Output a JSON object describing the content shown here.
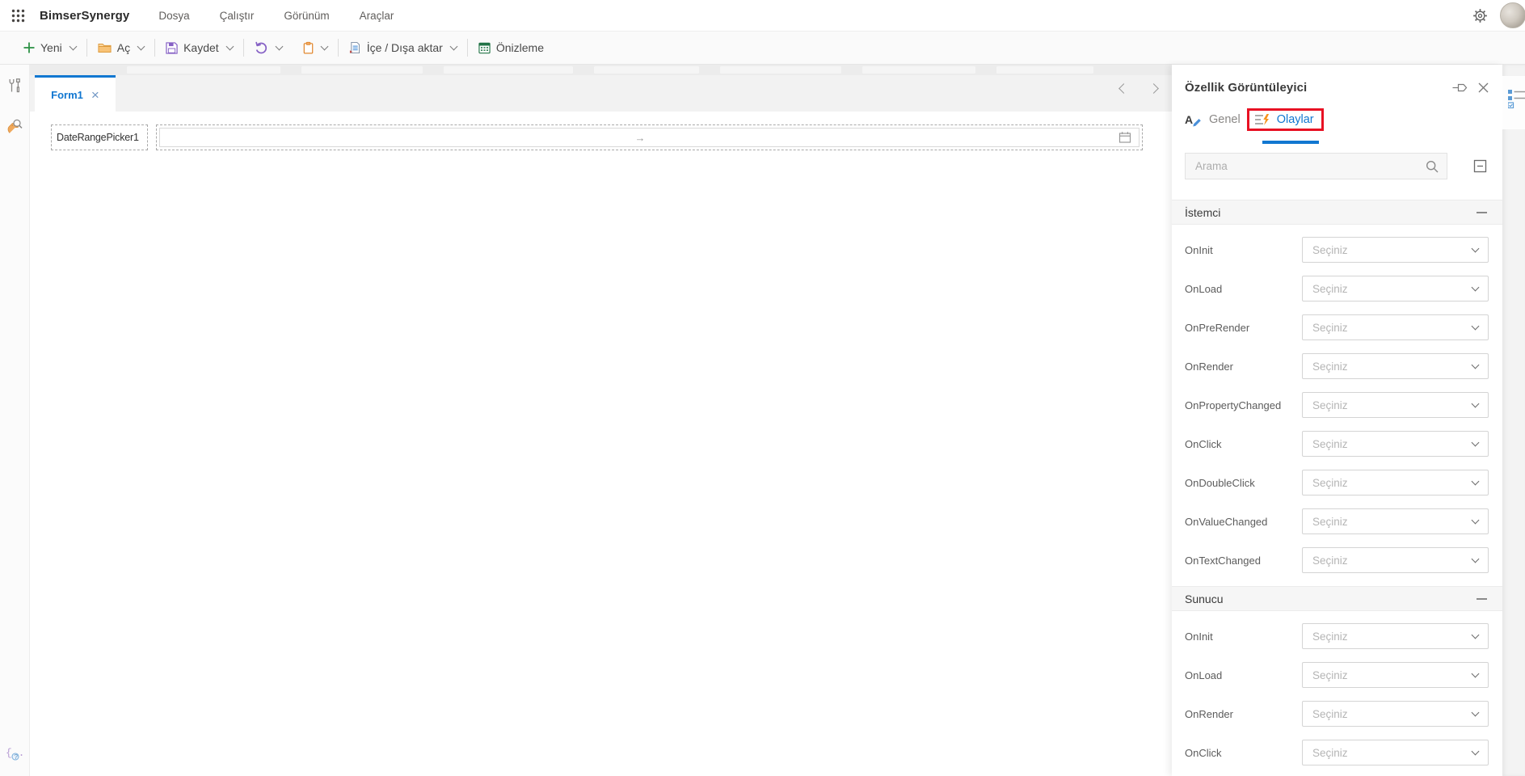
{
  "topbar": {
    "app_title": "BimserSynergy",
    "menus": [
      "Dosya",
      "Çalıştır",
      "Görünüm",
      "Araçlar"
    ]
  },
  "toolbar": {
    "new": "Yeni",
    "open": "Aç",
    "save": "Kaydet",
    "import_export": "İçe / Dışa aktar",
    "preview": "Önizleme"
  },
  "editor": {
    "tab": "Form1",
    "tab_close": "×",
    "component_label": "DateRangePicker1",
    "range_arrow": "→"
  },
  "panel": {
    "title": "Özellik Görüntüleyici",
    "tab_general": "Genel",
    "tab_events": "Olaylar",
    "search_placeholder": "Arama",
    "select_placeholder": "Seçiniz",
    "sections": [
      {
        "title": "İstemci",
        "events": [
          "OnInit",
          "OnLoad",
          "OnPreRender",
          "OnRender",
          "OnPropertyChanged",
          "OnClick",
          "OnDoubleClick",
          "OnValueChanged",
          "OnTextChanged"
        ]
      },
      {
        "title": "Sunucu",
        "events": [
          "OnInit",
          "OnLoad",
          "OnRender",
          "OnClick"
        ]
      }
    ]
  },
  "colors": {
    "accent_blue": "#1177d1",
    "annotation_red": "#e81123",
    "green": "#2e9147",
    "purple": "#8661c5",
    "orange_folder": "#e8a33d",
    "orange_clipboard": "#e0862c",
    "preview_green": "#217346"
  }
}
